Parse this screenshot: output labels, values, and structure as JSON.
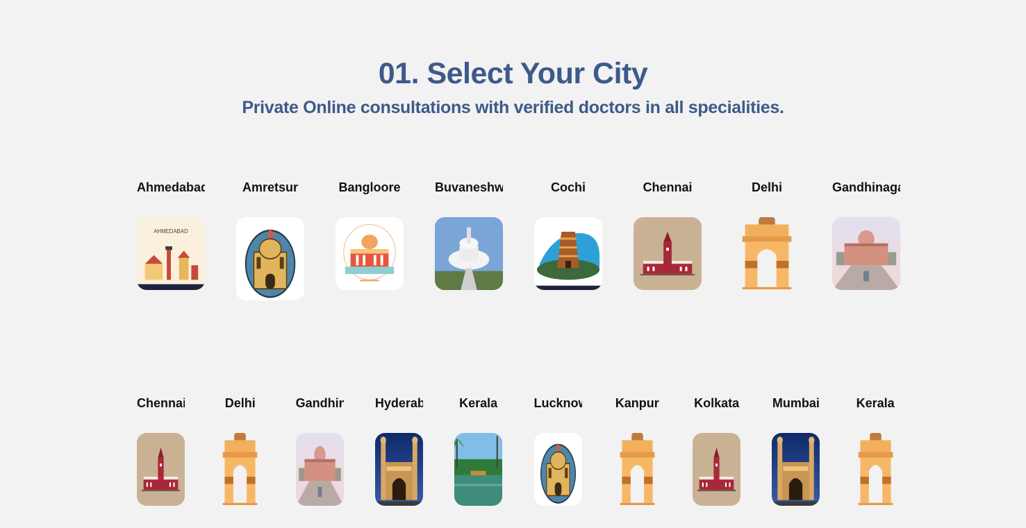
{
  "header": {
    "title": "01. Select Your City",
    "subtitle": "Private Online consultations with verified doctors in all specialities."
  },
  "row1": [
    {
      "label": "Ahmedabad",
      "icon": "ahmedabad-skyline-icon"
    },
    {
      "label": "Amretsur",
      "icon": "golden-temple-icon"
    },
    {
      "label": "Bangloore",
      "icon": "vidhana-soudha-icon"
    },
    {
      "label": "Buvaneshwar",
      "icon": "shanti-stupa-icon"
    },
    {
      "label": "Cochi",
      "icon": "temple-gopuram-icon"
    },
    {
      "label": "Chennai",
      "icon": "chennai-central-icon"
    },
    {
      "label": "Delhi",
      "icon": "india-gate-icon"
    },
    {
      "label": "Gandhinagar",
      "icon": "akshardham-icon"
    }
  ],
  "row2": [
    {
      "label": "Chennai",
      "icon": "chennai-central-icon"
    },
    {
      "label": "Delhi",
      "icon": "india-gate-icon"
    },
    {
      "label": "Gandhinagar",
      "icon": "akshardham-icon"
    },
    {
      "label": "Hyderabad",
      "icon": "charminar-icon"
    },
    {
      "label": "Kerala",
      "icon": "backwaters-icon"
    },
    {
      "label": "Lucknow",
      "icon": "golden-temple-icon"
    },
    {
      "label": "Kanpur",
      "icon": "india-gate-icon"
    },
    {
      "label": "Kolkata",
      "icon": "chennai-central-icon"
    },
    {
      "label": "Mumbai",
      "icon": "charminar-icon"
    },
    {
      "label": "Kerala",
      "icon": "india-gate-icon"
    }
  ]
}
